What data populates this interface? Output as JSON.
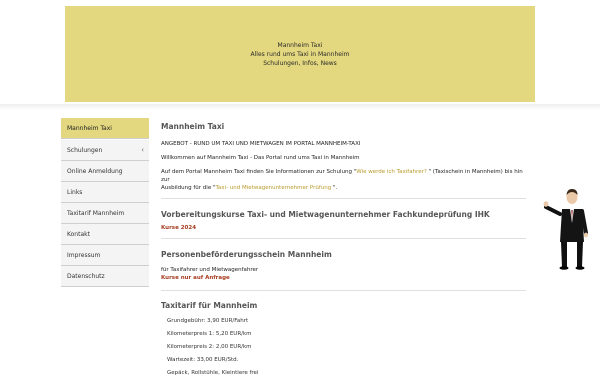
{
  "banner": {
    "line1": "Mannheim Taxi",
    "line2": "Alles rund ums Taxi in Mannheim",
    "line3": "Schulungen, Infos, News"
  },
  "sidebar": {
    "items": [
      {
        "label": "Mannheim Taxi",
        "active": true
      },
      {
        "label": "Schulungen",
        "has_submenu": true,
        "chevron": "‹"
      },
      {
        "label": "Online Anmeldung"
      },
      {
        "label": "Links"
      },
      {
        "label": "Taxitarif Mannheim"
      },
      {
        "label": "Kontakt"
      },
      {
        "label": "Impressum"
      },
      {
        "label": "Datenschutz"
      }
    ]
  },
  "main": {
    "section1": {
      "title": "Mannheim Taxi",
      "heading": "ANGEBOT - RUND UM TAXI UND MIETWAGEN IM PORTAL MANNHEIM-TAXI",
      "welcome": "Willkommen auf Mannheim Taxi - Das Portal rund ums Taxi in Mannheim",
      "text_a": "Auf dem Portal Mannheim Taxi finden Sie Informationen zur Schulung \"",
      "link_a": "Wie werde ich Taxifahrer?",
      "text_b": " \" (Taxischein in Mannheim) bis hin zur",
      "text_c": "Ausbildung für die \"",
      "link_b": "Taxi- und Mietwagenunternehmer Prüfung",
      "text_d": " \"."
    },
    "section2": {
      "title": "Vorbereitungskurse Taxi- und Mietwagenunternehmer Fachkundeprüfung IHK",
      "link": "Kurse 2024"
    },
    "section3": {
      "title": "Personenbeförderungsschein Mannheim",
      "text": "für Taxifahrer und Mietwagenfahrer",
      "link": "Kurse nur auf Anfrage"
    },
    "section4": {
      "title": "Taxitarif für Mannheim",
      "rows": [
        "Grundgebühr: 3,90 EUR/Fahrt",
        "Kilometerpreis 1: 5,20 EUR/km",
        "Kilometerpreis 2: 2,00 EUR/km",
        "Wartezeit: 33,00  EUR/Std.",
        "Gepäck, Rollstühle, Kleintiere frei"
      ]
    }
  },
  "colors": {
    "banner": "#e3d77f",
    "link_gold": "#b89a2a",
    "link_red": "#a63b1e"
  }
}
